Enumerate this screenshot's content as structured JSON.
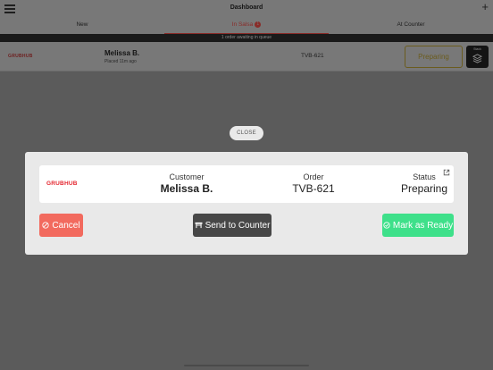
{
  "header": {
    "title": "Dashboard",
    "menu_icon": "hamburger-menu-icon",
    "add_icon": "plus-icon"
  },
  "tabs": [
    {
      "label": "New"
    },
    {
      "label": "In Salsa",
      "badge": "1",
      "active": true
    },
    {
      "label": "At Counter"
    }
  ],
  "banner": "1 order awaiting in queue",
  "order_row": {
    "provider": "GRUBHUB",
    "name": "Melissa B.",
    "placed": "Placed 11m ago",
    "code": "TVB-621",
    "status": "Preparing",
    "stack_label": "Stack"
  },
  "modal": {
    "close_label": "CLOSE",
    "provider_logo": "GRUBHUB",
    "customer_label": "Customer",
    "customer_value": "Melissa B.",
    "order_label": "Order",
    "order_value": "TVB-621",
    "status_label": "Status",
    "status_value": "Preparing",
    "cancel_label": "Cancel",
    "send_label": "Send to Counter",
    "ready_label": "Mark as Ready"
  },
  "colors": {
    "brand_red": "#e4262f",
    "cancel": "#f26a5e",
    "send": "#474747",
    "ready": "#3ee08a"
  }
}
